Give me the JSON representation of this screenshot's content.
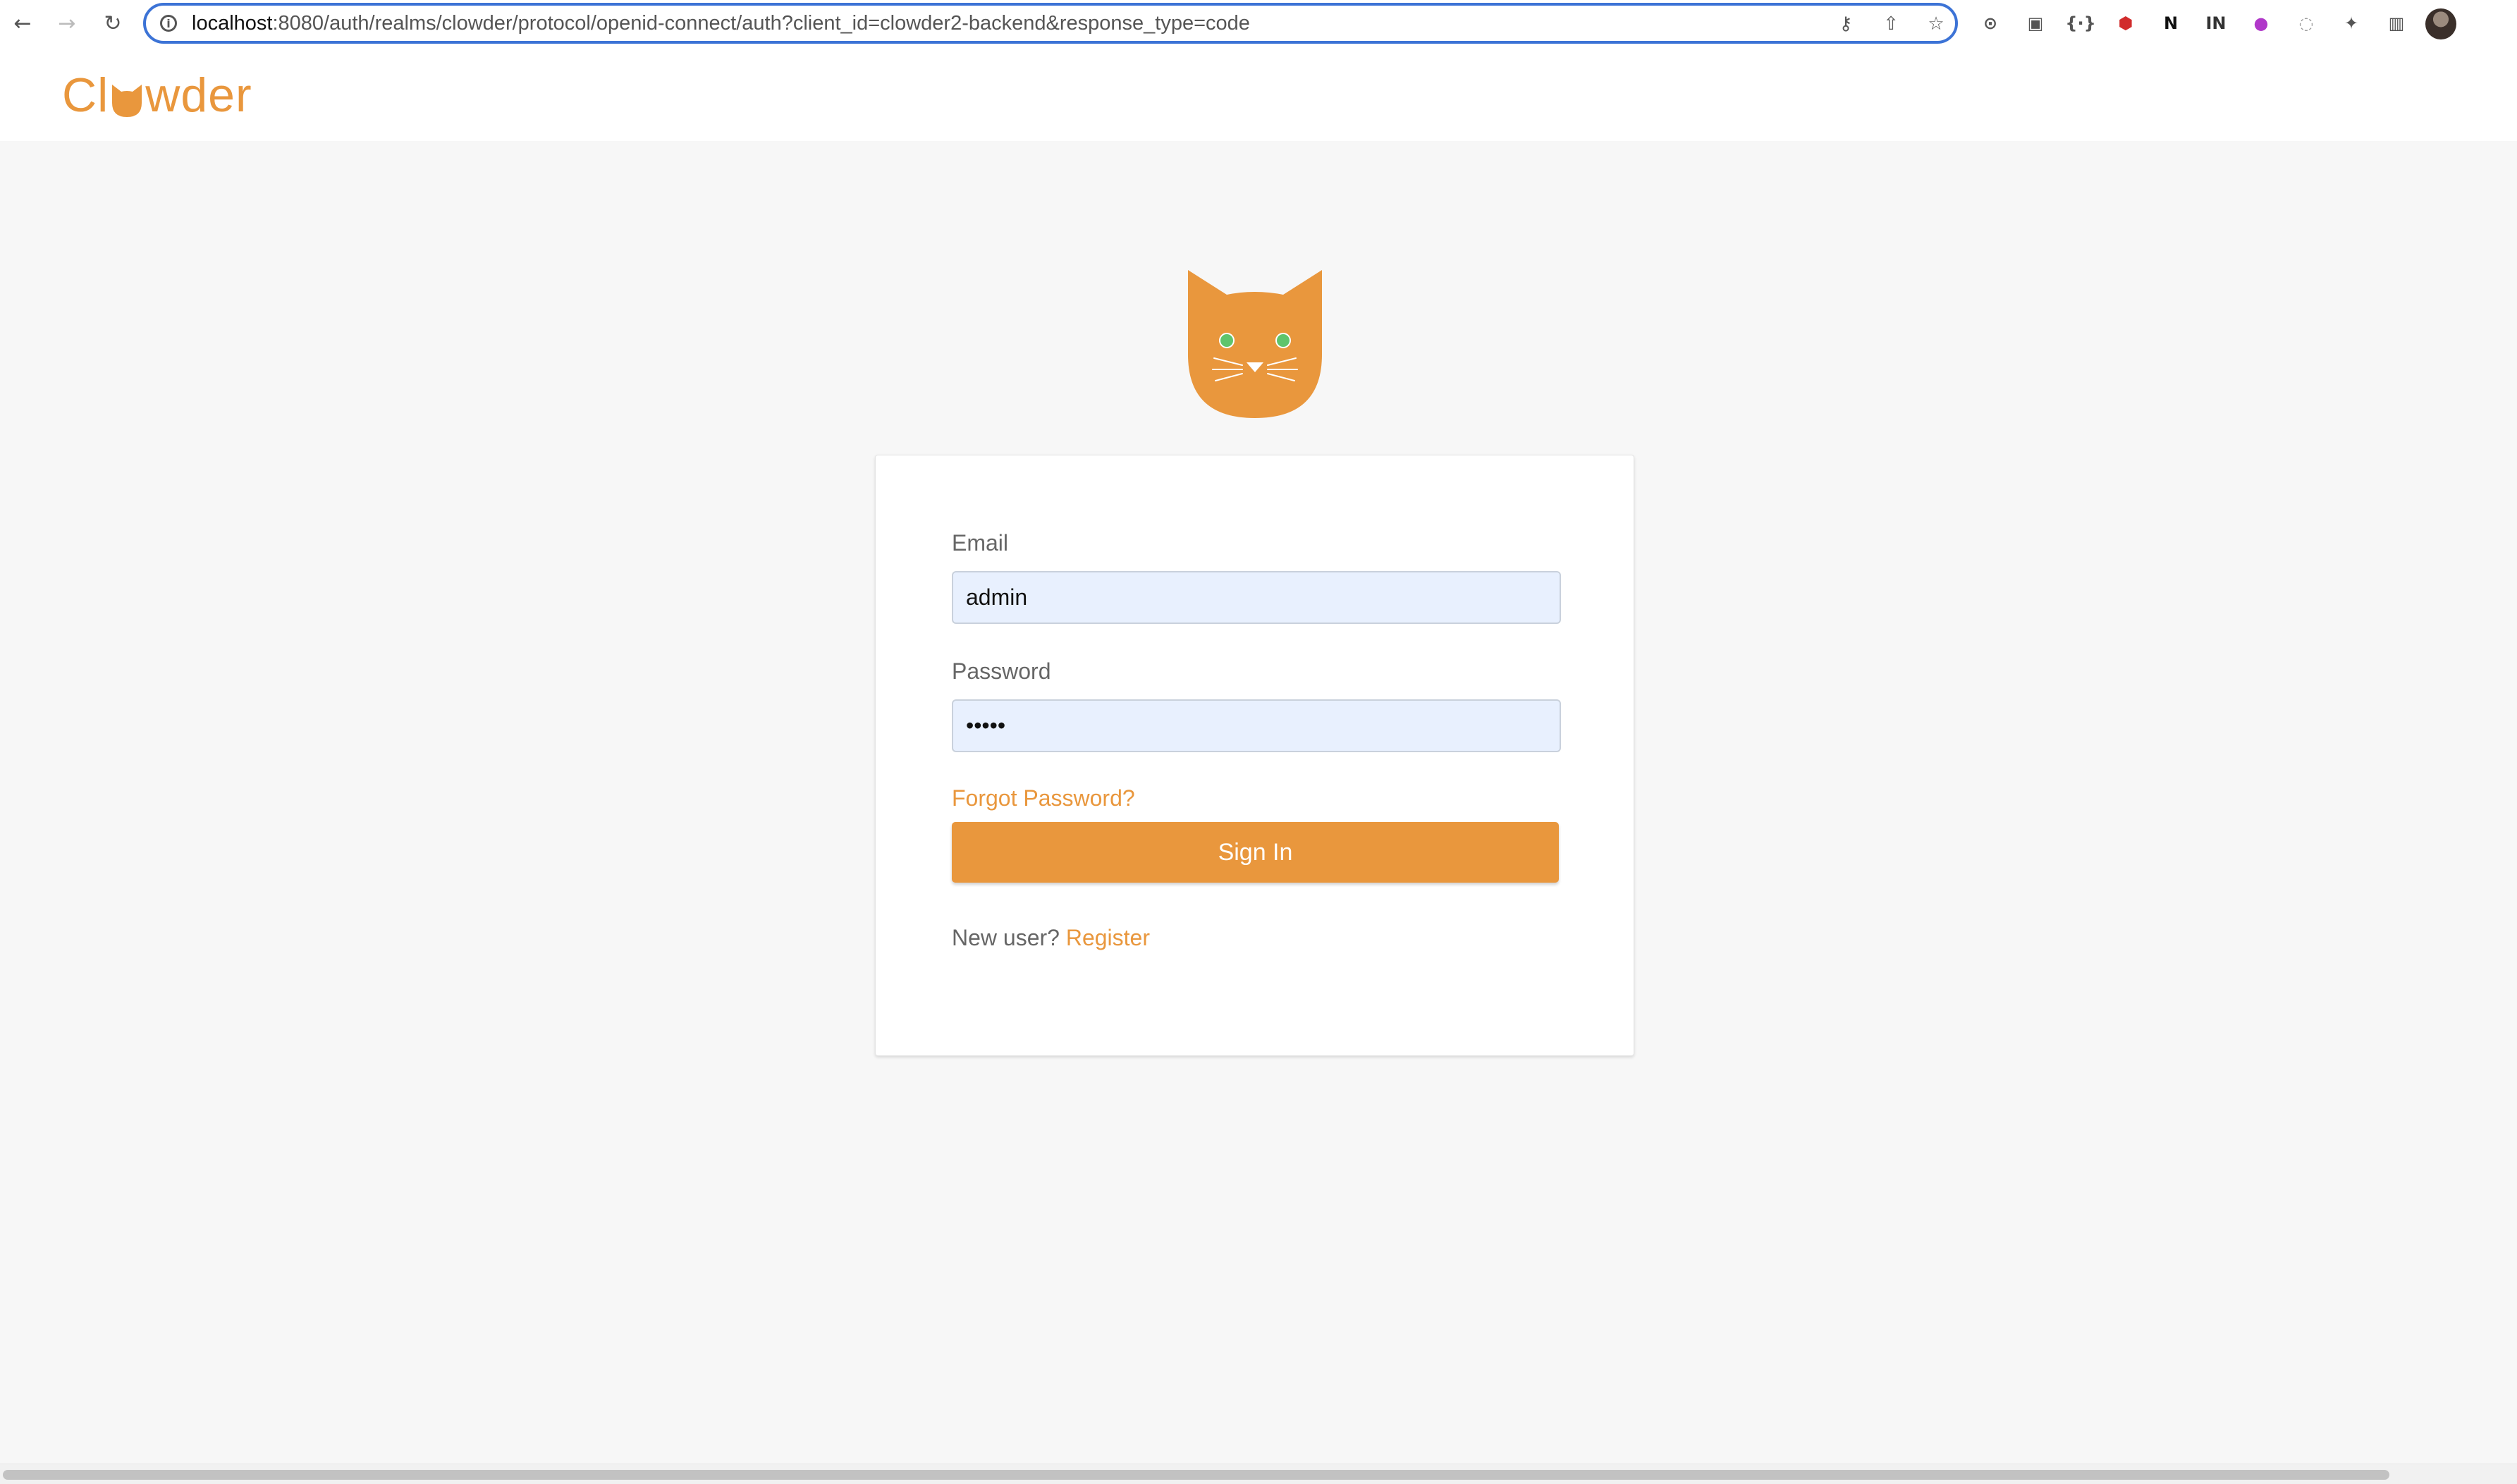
{
  "browser": {
    "url_host": "localhost",
    "url_rest": ":8080/auth/realms/clowder/protocol/openid-connect/auth?client_id=clowder2-backend&response_type=code",
    "site_info_icon": "i",
    "nav_icons": [
      "back-arrow-icon",
      "forward-arrow-icon",
      "reload-icon"
    ],
    "address_actions": [
      "key-icon",
      "share-icon",
      "star-icon"
    ],
    "extensions": [
      {
        "name": "extension-icon-1",
        "glyph": "⊙",
        "color": "#555555"
      },
      {
        "name": "extension-icon-2",
        "glyph": "▣",
        "color": "#555555"
      },
      {
        "name": "extension-icon-3",
        "glyph": "{∙}",
        "color": "#555555"
      },
      {
        "name": "extension-icon-4",
        "glyph": "⬢",
        "color": "#d12c2c"
      },
      {
        "name": "notion-icon",
        "glyph": "N",
        "color": "#111111"
      },
      {
        "name": "extension-icon-6",
        "glyph": "IN",
        "color": "#333333"
      },
      {
        "name": "extension-icon-7",
        "glyph": "●",
        "color": "#b038c9"
      },
      {
        "name": "extension-icon-8",
        "glyph": "◌",
        "color": "#999999"
      },
      {
        "name": "puzzle-icon",
        "glyph": "✦",
        "color": "#555555"
      },
      {
        "name": "sidebar-toggle-icon",
        "glyph": "▥",
        "color": "#555555"
      }
    ]
  },
  "header": {
    "brand_prefix": "Cl",
    "brand_suffix": "wder",
    "brand_color": "#e9973d"
  },
  "login": {
    "email_label": "Email",
    "email_value": "admin",
    "password_label": "Password",
    "password_value": "admin",
    "forgot_password": "Forgot Password?",
    "sign_in": "Sign In",
    "new_user": "New user?",
    "register": "Register",
    "accent_color": "#e9973d",
    "input_bg": "#e8f0fe"
  }
}
